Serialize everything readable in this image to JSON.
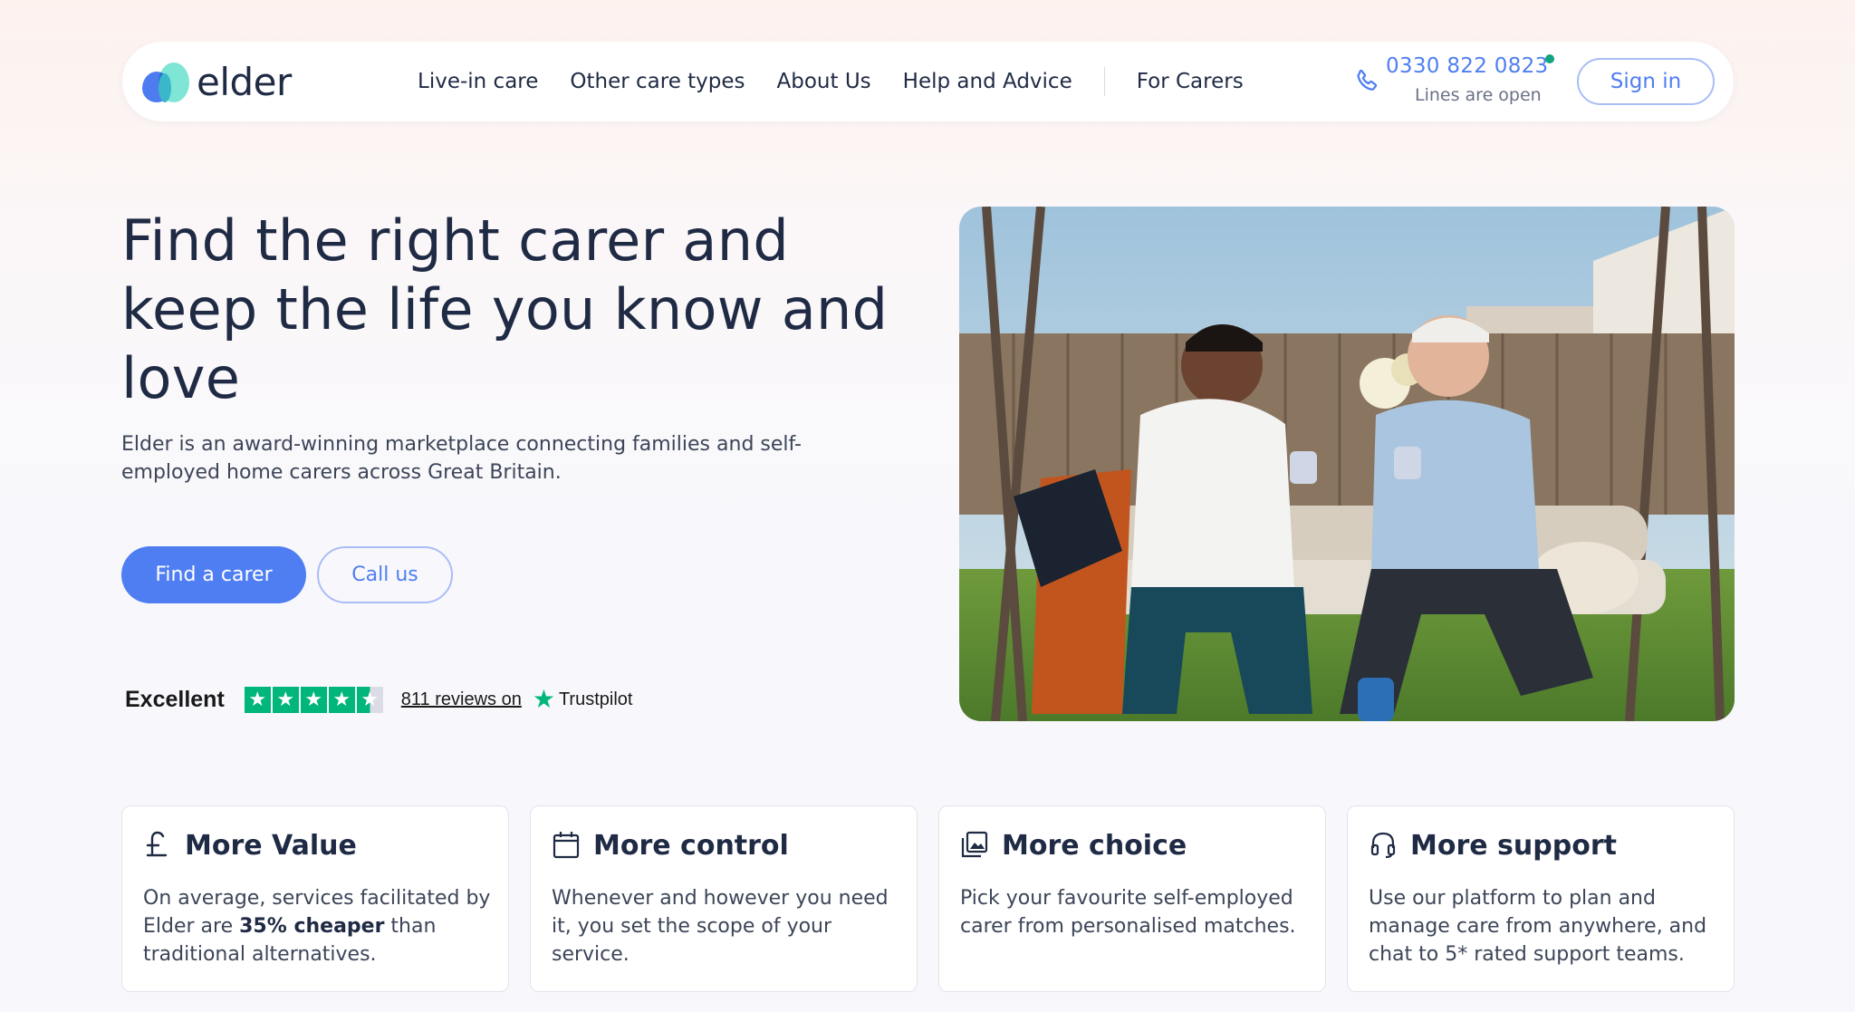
{
  "brand": {
    "name": "elder"
  },
  "nav": {
    "items": [
      {
        "label": "Live-in care"
      },
      {
        "label": "Other care types"
      },
      {
        "label": "About Us"
      },
      {
        "label": "Help and Advice"
      },
      {
        "label": "For Carers"
      }
    ],
    "phone": "0330 822 0823",
    "phone_status": "Lines are open",
    "sign_in": "Sign in"
  },
  "hero": {
    "title": "Find the right carer and keep the life you know and love",
    "subtitle": "Elder is an award-winning marketplace connecting families and self-employed home carers across Great Britain.",
    "primary_cta": "Find a carer",
    "secondary_cta": "Call us"
  },
  "trustpilot": {
    "rating_text": "Excellent",
    "stars": 4.5,
    "reviews_text": "811 reviews on",
    "brand": "Trustpilot"
  },
  "features": [
    {
      "title": "More Value",
      "body_pre": "On average, services facilitated by Elder are ",
      "body_bold": "35% cheaper",
      "body_post": " than traditional alternatives.",
      "icon": "pound-icon"
    },
    {
      "title": "More control",
      "body": "Whenever and however you need it, you set the scope of your service.",
      "icon": "calendar-icon"
    },
    {
      "title": "More choice",
      "body": "Pick your favourite self-employed carer from personalised matches.",
      "icon": "gallery-icon"
    },
    {
      "title": "More support",
      "body": "Use our platform to plan and manage care from anywhere, and chat to 5* rated support teams.",
      "icon": "headset-icon"
    }
  ],
  "colors": {
    "accent": "#4f7ef2",
    "text": "#1f2a44",
    "trustpilot_green": "#00b67a",
    "status_green": "#12a37f"
  }
}
